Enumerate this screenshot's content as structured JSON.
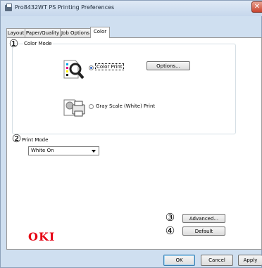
{
  "window": {
    "title": "Pro8432WT PS Printing Preferences",
    "close_glyph": "✕"
  },
  "tabs": [
    {
      "label": "Layout"
    },
    {
      "label": "Paper/Quality"
    },
    {
      "label": "Job Options"
    },
    {
      "label": "Color"
    }
  ],
  "color_mode": {
    "number": "①",
    "label": "Color Mode",
    "color_print_label": "Color Print",
    "color_print_selected": true,
    "options_button": "Options...",
    "grayscale_label": "Gray Scale (White) Print",
    "grayscale_selected": false
  },
  "print_mode": {
    "number": "②",
    "label": "Print Mode",
    "selected_value": "White On"
  },
  "advanced": {
    "number": "③",
    "label": "Advanced..."
  },
  "default": {
    "number": "④",
    "label": "Default"
  },
  "brand": {
    "logo_text": "OKI",
    "logo_color": "#e60012"
  },
  "buttons": {
    "ok": "OK",
    "cancel": "Cancel",
    "apply": "Apply"
  }
}
